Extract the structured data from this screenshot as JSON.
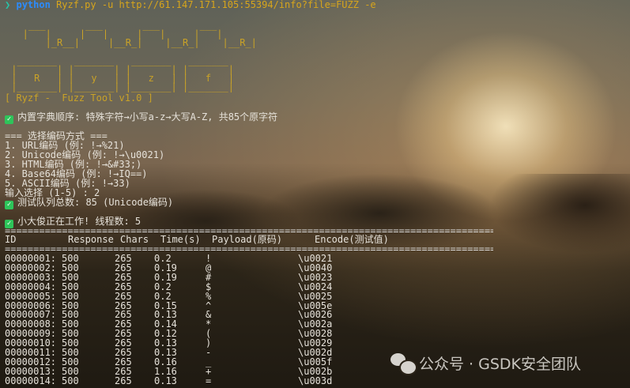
{
  "command": {
    "prompt": "❯",
    "program": "python",
    "args": "Ryzf.py -u http://61.147.171.105:55394/info?file=FUZZ -e"
  },
  "banner_letters": [
    "R",
    "y",
    "z",
    "f"
  ],
  "tool_title": "[ Ryzf -  Fuzz Tool v1.0 ]",
  "dict_info": "内置字典顺序: 特殊字符→小写a-z→大写A-Z, 共85个原字符",
  "menu": {
    "title": "=== 选择编码方式 ===",
    "options": [
      "1. URL编码 (例: !→%21)",
      "2. Unicode编码 (例: !→\\u0021)",
      "3. HTML编码 (例: !→&#33;)",
      "4. Base64编码 (例: !→IQ==)",
      "5. ASCII编码 (例: !→33)"
    ],
    "input_prompt": "输入选择 (1-5) : 2"
  },
  "queue_info": "测试队列总数: 85 (Unicode编码)",
  "working_info": "小大俊正在工作! 线程数: 5",
  "table": {
    "headers": [
      "ID",
      "Response",
      "Chars",
      "Time(s)",
      "Payload(原码)",
      "Encode(测试值)"
    ],
    "rows": [
      [
        "00000001:",
        "500",
        "265",
        "0.2",
        "!",
        "\\u0021"
      ],
      [
        "00000002:",
        "500",
        "265",
        "0.19",
        "@",
        "\\u0040"
      ],
      [
        "00000003:",
        "500",
        "265",
        "0.19",
        "#",
        "\\u0023"
      ],
      [
        "00000004:",
        "500",
        "265",
        "0.2",
        "$",
        "\\u0024"
      ],
      [
        "00000005:",
        "500",
        "265",
        "0.2",
        "%",
        "\\u0025"
      ],
      [
        "00000006:",
        "500",
        "265",
        "0.15",
        "^",
        "\\u005e"
      ],
      [
        "00000007:",
        "500",
        "265",
        "0.13",
        "&",
        "\\u0026"
      ],
      [
        "00000008:",
        "500",
        "265",
        "0.14",
        "*",
        "\\u002a"
      ],
      [
        "00000009:",
        "500",
        "265",
        "0.12",
        "(",
        "\\u0028"
      ],
      [
        "00000010:",
        "500",
        "265",
        "0.13",
        ")",
        "\\u0029"
      ],
      [
        "00000011:",
        "500",
        "265",
        "0.13",
        "-",
        "\\u002d"
      ],
      [
        "00000012:",
        "500",
        "265",
        "0.16",
        "_",
        "\\u005f"
      ],
      [
        "00000013:",
        "500",
        "265",
        "1.16",
        "+",
        "\\u002b"
      ],
      [
        "00000014:",
        "500",
        "265",
        "0.13",
        "=",
        "\\u003d"
      ]
    ]
  },
  "watermark": "公众号 · GSDK安全团队",
  "colors": {
    "check": "#2ec45a",
    "banner": "#c9a227",
    "python": "#2b8cff"
  }
}
